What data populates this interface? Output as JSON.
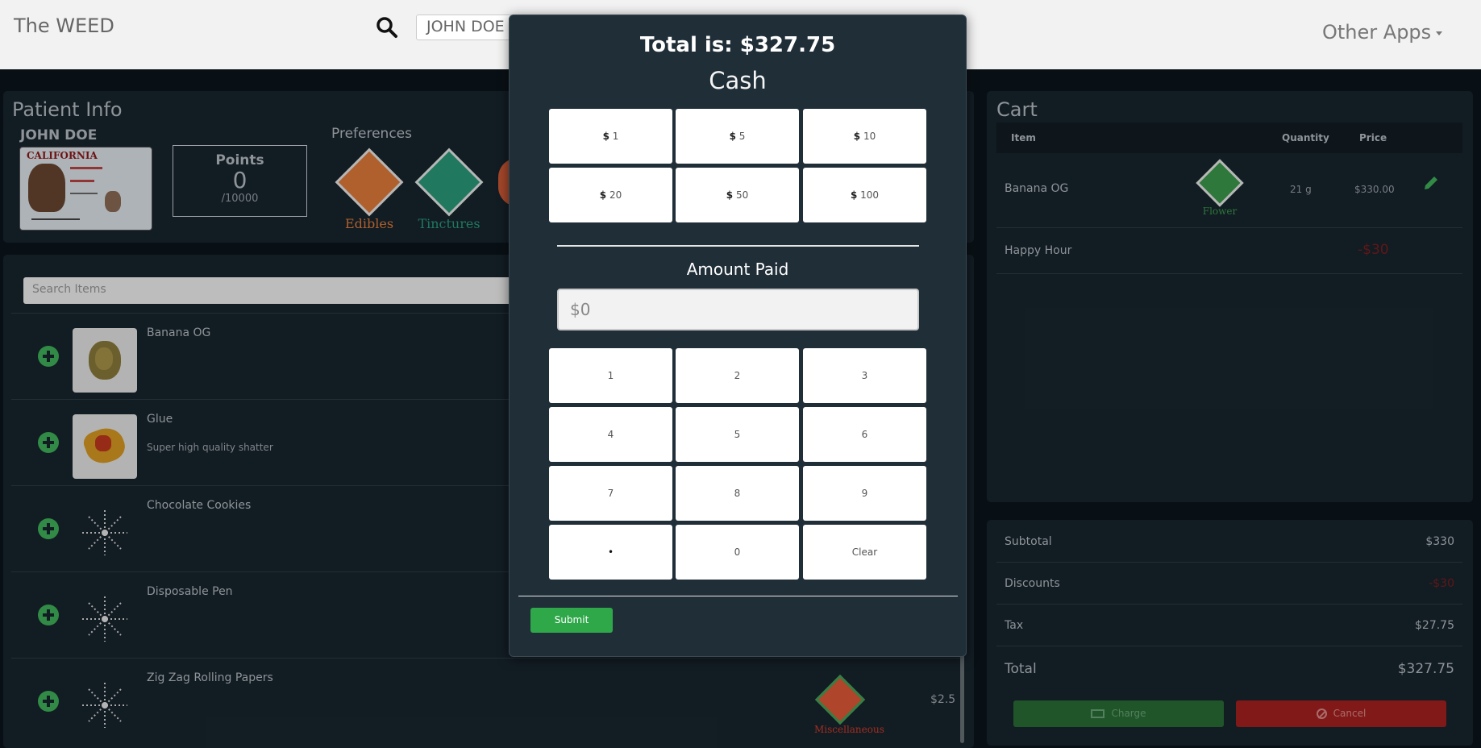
{
  "navbar": {
    "brand": "The WEED",
    "search_value": "JOHN DOE",
    "other_apps": "Other Apps"
  },
  "patient": {
    "title": "Patient Info",
    "name": "JOHN DOE",
    "license_state": "CALIFORNIA",
    "points_label": "Points",
    "points_value": "0",
    "points_max": "/10000",
    "preferences_title": "Preferences",
    "preferences": [
      {
        "label": "Edibles",
        "color": "#e07b3a"
      },
      {
        "label": "Tinctures",
        "color": "#2a9a7a"
      }
    ]
  },
  "items": {
    "search_placeholder": "Search Items",
    "rows": [
      {
        "name": "Banana OG",
        "desc": ""
      },
      {
        "name": "Glue",
        "desc": "Super high quality shatter"
      },
      {
        "name": "Chocolate Cookies",
        "desc": ""
      },
      {
        "name": "Disposable Pen",
        "desc": ""
      },
      {
        "name": "Zig Zag Rolling Papers",
        "desc": "",
        "category": "Miscellaneous",
        "price": "$2.5"
      }
    ]
  },
  "cart": {
    "title": "Cart",
    "columns": [
      "Item",
      "Quantity",
      "Price"
    ],
    "rows": [
      {
        "item": "Banana OG",
        "category": "Flower",
        "quantity": "21 g",
        "price": "$330.00"
      },
      {
        "item": "Happy Hour",
        "price": "-$30"
      }
    ]
  },
  "totals": {
    "subtotal_label": "Subtotal",
    "subtotal": "$330",
    "discounts_label": "Discounts",
    "discounts": "-$30",
    "tax_label": "Tax",
    "tax": "$27.75",
    "total_label": "Total",
    "total": "$327.75",
    "charge": "Charge",
    "cancel": "Cancel"
  },
  "modal": {
    "title": "Total is: $327.75",
    "method": "Cash",
    "currency_symbol": "$",
    "quick_amounts": [
      "1",
      "5",
      "10",
      "20",
      "50",
      "100"
    ],
    "amount_paid_label": "Amount Paid",
    "amount_placeholder": "$0",
    "keypad": [
      "1",
      "2",
      "3",
      "4",
      "5",
      "6",
      "7",
      "8",
      "9",
      "•",
      "0",
      "Clear"
    ],
    "submit": "Submit"
  },
  "colors": {
    "accent_green": "#2fa84a",
    "danger_red": "#a5201f",
    "panel": "#18252e",
    "modal": "#202e38"
  }
}
